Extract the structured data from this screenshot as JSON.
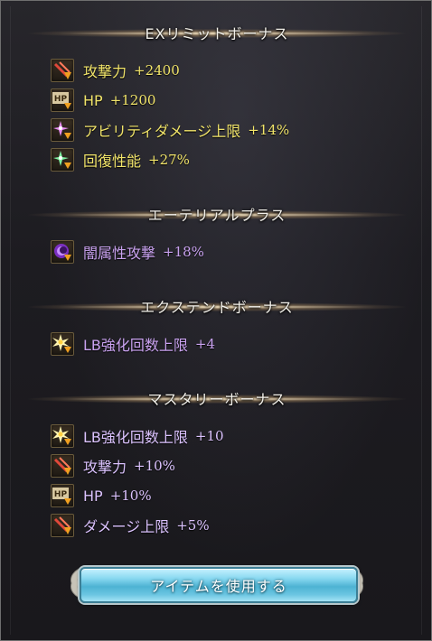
{
  "sections": [
    {
      "title": "EXリミットボーナス",
      "items": [
        {
          "icon": "attack-icon",
          "label": "攻撃力",
          "value": "+2400"
        },
        {
          "icon": "hp-icon",
          "label": "HP",
          "value": "+1200"
        },
        {
          "icon": "ability-damage-icon",
          "label": "アビリティダメージ上限",
          "value": "+14%"
        },
        {
          "icon": "healing-icon",
          "label": "回復性能",
          "value": "+27%"
        }
      ]
    },
    {
      "title": "エーテリアルプラス",
      "items": [
        {
          "icon": "dark-element-icon",
          "label": "闇属性攻撃",
          "value": "+18%"
        }
      ]
    },
    {
      "title": "エクステンドボーナス",
      "items": [
        {
          "icon": "limit-break-icon",
          "label": "LB強化回数上限",
          "value": "+4"
        }
      ]
    },
    {
      "title": "マスタリーボーナス",
      "items": [
        {
          "icon": "limit-break-icon",
          "label": "LB強化回数上限",
          "value": "+10"
        },
        {
          "icon": "attack-icon",
          "label": "攻撃力",
          "value": "+10%"
        },
        {
          "icon": "hp-icon",
          "label": "HP",
          "value": "+10%"
        },
        {
          "icon": "attack-icon",
          "label": "ダメージ上限",
          "value": "+5%"
        }
      ]
    }
  ],
  "button": {
    "label": "アイテムを使用する"
  },
  "colors": {
    "ex_text": "#f1e46a",
    "other_text": "#c9a2f0",
    "button": "#6cc6e2"
  }
}
